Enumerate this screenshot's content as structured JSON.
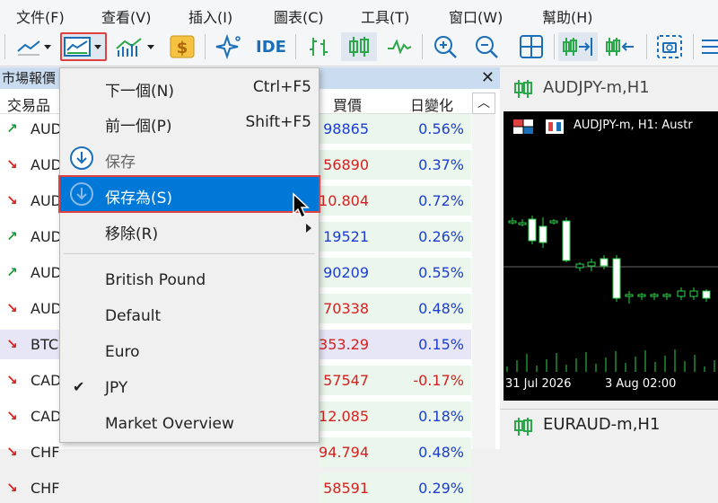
{
  "menubar": [
    "文件(F)",
    "查看(V)",
    "插入(I)",
    "圖表(C)",
    "工具(T)",
    "窗口(W)",
    "幫助(H)"
  ],
  "toolbar": {
    "ide_label": "IDE"
  },
  "market_watch": {
    "title": "市場報價",
    "col_symbol": "交易品",
    "col_bid": "買價",
    "col_change": "日變化",
    "rows": [
      {
        "sym": "AUD",
        "dir": "up",
        "bid": "98865",
        "chg": "0.56%"
      },
      {
        "sym": "AUD",
        "dir": "dn",
        "bid": "56890",
        "chg": "0.37%"
      },
      {
        "sym": "AUD",
        "dir": "dn",
        "bid": "10.804",
        "chg": "0.72%"
      },
      {
        "sym": "AUD",
        "dir": "up",
        "bid": "19521",
        "chg": "0.26%"
      },
      {
        "sym": "AUD",
        "dir": "up",
        "bid": "90209",
        "chg": "0.55%"
      },
      {
        "sym": "AUD",
        "dir": "dn",
        "bid": "70338",
        "chg": "0.48%"
      },
      {
        "sym": "BTC",
        "dir": "dn",
        "bid": "353.29",
        "chg": "0.15%"
      },
      {
        "sym": "CAD",
        "dir": "dn",
        "bid": "57547",
        "chg": "-0.17%"
      },
      {
        "sym": "CAD",
        "dir": "dn",
        "bid": "12.085",
        "chg": "0.18%"
      },
      {
        "sym": "CHF",
        "dir": "dn",
        "bid": "94.794",
        "chg": "0.48%"
      },
      {
        "sym": "CHF",
        "dir": "dn",
        "bid": "58591",
        "chg": "0.29%"
      }
    ]
  },
  "dropdown": {
    "next": "下一個(N)",
    "next_sc": "Ctrl+F5",
    "prev": "前一個(P)",
    "prev_sc": "Shift+F5",
    "save": "保存",
    "save_as": "保存為(S)",
    "remove": "移除(R)",
    "templates": [
      "British Pound",
      "Default",
      "Euro",
      "JPY",
      "Market Overview"
    ],
    "checked": "JPY"
  },
  "chart": {
    "window_title": "AUDJPY-m,H1",
    "header_text": "AUDJPY-m, H1:  Austr",
    "x_labels": [
      "31 Jul 2026",
      "3 Aug 02:00"
    ],
    "second_window_title": "EURAUD-m,H1"
  }
}
